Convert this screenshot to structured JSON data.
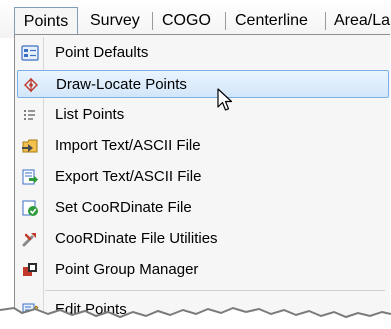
{
  "menubar": {
    "tabs": [
      {
        "label": "Points",
        "active": true
      },
      {
        "label": "Survey"
      },
      {
        "label": "COGO"
      },
      {
        "label": "Centerline"
      },
      {
        "label": "Area/La"
      }
    ]
  },
  "dropdown": {
    "items": [
      {
        "label": "Point Defaults",
        "icon": "point-defaults-icon"
      },
      {
        "label": "Draw-Locate Points",
        "icon": "draw-locate-icon",
        "highlighted": true
      },
      {
        "label": "List Points",
        "icon": "list-icon"
      },
      {
        "label": "Import Text/ASCII File",
        "icon": "import-file-icon"
      },
      {
        "label": "Export Text/ASCII File",
        "icon": "export-file-icon"
      },
      {
        "label": "Set CooRDinate File",
        "icon": "set-coordinate-file-icon"
      },
      {
        "label": "CooRDinate File Utilities",
        "icon": "coordinate-utilities-icon"
      },
      {
        "label": "Point Group Manager",
        "icon": "point-group-icon"
      },
      {
        "label": "Edit Points",
        "icon": "edit-points-icon"
      }
    ]
  },
  "colors": {
    "highlight_border": "#7ab0e6",
    "highlight_fill": "#d2e6fa",
    "menu_background": "#f6f6f6"
  }
}
